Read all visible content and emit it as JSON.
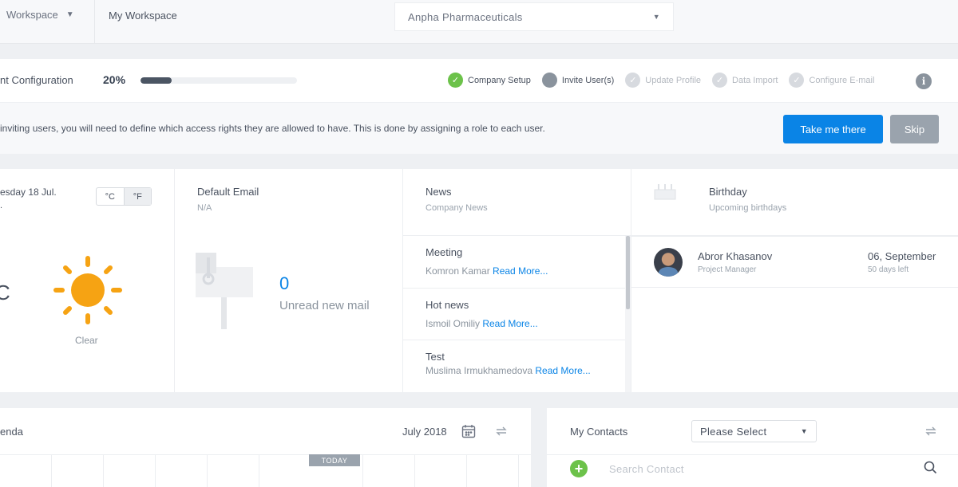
{
  "topbar": {
    "workspace_switch": "Workspace",
    "current_workspace": "My Workspace",
    "company": "Anpha Pharmaceuticals"
  },
  "config": {
    "title": "nt Configuration",
    "percent_label": "20%",
    "progress": 0.2,
    "steps": [
      {
        "label": "Company Setup",
        "state": "done"
      },
      {
        "label": "Invite User(s)",
        "state": "current"
      },
      {
        "label": "Update Profile",
        "state": "todo"
      },
      {
        "label": "Data Import",
        "state": "todo"
      },
      {
        "label": "Configure E-mail",
        "state": "todo"
      }
    ]
  },
  "message": {
    "text": "inviting users, you will need to define which access rights they are allowed to have. This is done by assigning a role to each user.",
    "primary_label": "Take me there",
    "secondary_label": "Skip"
  },
  "weather": {
    "date": "esday 18 Jul.",
    "sub": ".",
    "unit_c": "°C",
    "unit_f": "°F",
    "temp": "C",
    "condition": "Clear"
  },
  "email": {
    "title": "Default Email",
    "sub": "N/A",
    "count": "0",
    "label": "Unread new mail"
  },
  "news": {
    "title": "News",
    "sub": "Company News",
    "read_more": "Read More...",
    "items": [
      {
        "title": "Meeting",
        "author": "Komron Kamar"
      },
      {
        "title": "Hot news",
        "author": "Ismoil Omiliy"
      },
      {
        "title": "Test",
        "author": "Muslima Irmukhamedova"
      }
    ]
  },
  "birthday": {
    "title": "Birthday",
    "sub": "Upcoming birthdays",
    "entries": [
      {
        "name": "Abror Khasanov",
        "role": "Project Manager",
        "date": "06, September",
        "days_left": "50 days left"
      }
    ]
  },
  "agenda": {
    "title": "enda",
    "month": "July 2018",
    "today": "TODAY"
  },
  "contacts": {
    "title": "My Contacts",
    "select_value": "Please Select",
    "search_placeholder": "Search Contact"
  },
  "colors": {
    "accent": "#0a84e6",
    "success": "#6cc24a",
    "muted": "#9aa3ad"
  }
}
